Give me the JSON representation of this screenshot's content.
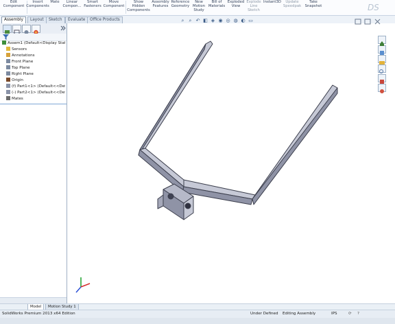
{
  "ribbon": [
    {
      "lines": [
        "Edit",
        "Component"
      ],
      "dim": false
    },
    {
      "lines": [
        "Insert",
        "Components"
      ],
      "dim": false
    },
    {
      "lines": [
        "Mate"
      ],
      "dim": false
    },
    {
      "lines": [
        "Linear",
        "Compon..."
      ],
      "dim": false
    },
    {
      "lines": [
        "Smart",
        "Fasteners"
      ],
      "dim": false
    },
    {
      "lines": [
        "Move",
        "Component"
      ],
      "dim": false
    },
    {
      "lines": [
        "Show",
        "Hidden",
        "Components"
      ],
      "dim": false
    },
    {
      "lines": [
        "Assembly",
        "Features"
      ],
      "dim": false
    },
    {
      "lines": [
        "Reference",
        "Geometry"
      ],
      "dim": false
    },
    {
      "lines": [
        "New",
        "Motion",
        "Study"
      ],
      "dim": false
    },
    {
      "lines": [
        "Bill of",
        "Materials"
      ],
      "dim": false
    },
    {
      "lines": [
        "Exploded",
        "View"
      ],
      "dim": false
    },
    {
      "lines": [
        "Explode",
        "Line",
        "Sketch"
      ],
      "dim": true
    },
    {
      "lines": [
        "Instant3D"
      ],
      "dim": false
    },
    {
      "lines": [
        "Update",
        "Speedpak"
      ],
      "dim": true
    },
    {
      "lines": [
        "Take",
        "Snapshot"
      ],
      "dim": false
    }
  ],
  "tabs": [
    "Assembly",
    "Layout",
    "Sketch",
    "Evaluate",
    "Office Products"
  ],
  "tree": [
    {
      "label": "Assem1  (Default<Display State",
      "indent": 0,
      "icon": "assembly-icon"
    },
    {
      "label": "Sensors",
      "indent": 1,
      "icon": "sensors-icon"
    },
    {
      "label": "Annotations",
      "indent": 1,
      "icon": "annotations-icon"
    },
    {
      "label": "Front Plane",
      "indent": 1,
      "icon": "plane-icon"
    },
    {
      "label": "Top Plane",
      "indent": 1,
      "icon": "plane-icon"
    },
    {
      "label": "Right Plane",
      "indent": 1,
      "icon": "plane-icon"
    },
    {
      "label": "Origin",
      "indent": 1,
      "icon": "origin-icon"
    },
    {
      "label": "(f) Part1<1> (Default<<Def",
      "indent": 1,
      "icon": "part-icon"
    },
    {
      "label": "(-) Part2<1> (Default<<Def",
      "indent": 1,
      "icon": "part-icon"
    },
    {
      "label": "Mates",
      "indent": 1,
      "icon": "mates-icon"
    }
  ],
  "model_tabs": [
    "Model",
    "Motion Study 1"
  ],
  "status": {
    "app": "SolidWorks Premium 2013 x64 Edition",
    "defined": "Under Defined",
    "mode": "Editing Assembly",
    "units": "IPS"
  },
  "colors": {
    "ribbon_bg": "#fbfcfe",
    "model_face": "#c6c9d6",
    "model_edge": "#3b3e4c"
  }
}
